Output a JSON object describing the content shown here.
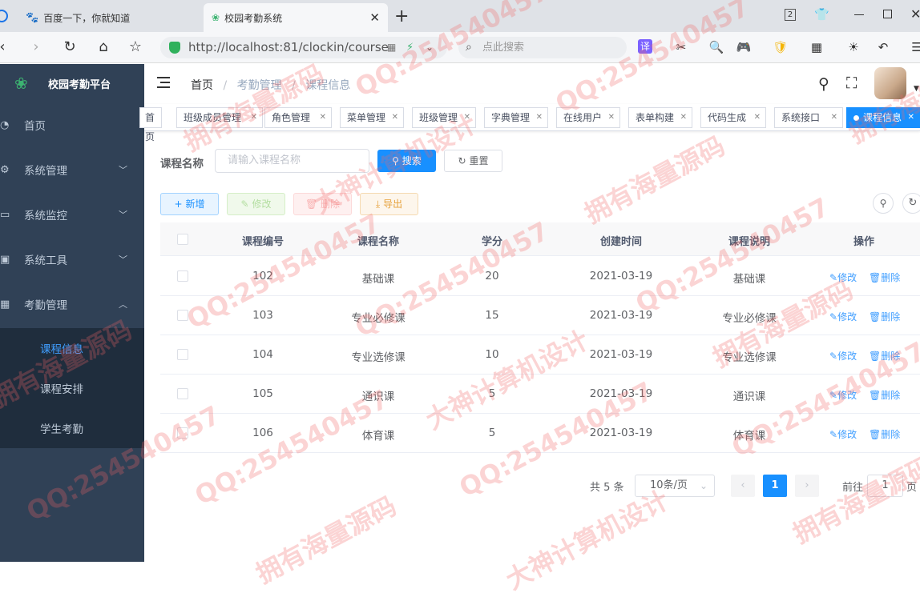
{
  "browser": {
    "tabs": [
      {
        "title": "百度一下，你就知道",
        "icon": "baidu-paw-icon"
      },
      {
        "title": "校园考勤系统",
        "icon": "app-logo-icon"
      }
    ],
    "tab_count": "2",
    "url_host": "http://localhost",
    "url_rest": ":81/clockin/course",
    "search_placeholder": "点此搜索",
    "translate_label": "译"
  },
  "app": {
    "name": "校园考勤平台",
    "breadcrumb": [
      "首页",
      "考勤管理",
      "课程信息"
    ]
  },
  "sidebar": {
    "items": [
      {
        "label": "首页",
        "icon": "dashboard-icon",
        "arrow": false
      },
      {
        "label": "系统管理",
        "icon": "gear-icon",
        "arrow": true
      },
      {
        "label": "系统监控",
        "icon": "monitor-icon",
        "arrow": true
      },
      {
        "label": "系统工具",
        "icon": "toolbox-icon",
        "arrow": true
      },
      {
        "label": "考勤管理",
        "icon": "table-icon",
        "arrow": true
      }
    ],
    "subitems": [
      {
        "label": "课程信息",
        "active": true
      },
      {
        "label": "课程安排",
        "active": false
      },
      {
        "label": "学生考勤",
        "active": false
      }
    ]
  },
  "tags": [
    {
      "label": "首页",
      "active": false
    },
    {
      "label": "班级成员管理",
      "active": false
    },
    {
      "label": "角色管理",
      "active": false
    },
    {
      "label": "菜单管理",
      "active": false
    },
    {
      "label": "班级管理",
      "active": false
    },
    {
      "label": "字典管理",
      "active": false
    },
    {
      "label": "在线用户",
      "active": false
    },
    {
      "label": "表单构建",
      "active": false
    },
    {
      "label": "代码生成",
      "active": false
    },
    {
      "label": "系统接口",
      "active": false
    },
    {
      "label": "课程信息",
      "active": true
    }
  ],
  "query": {
    "label": "课程名称",
    "placeholder": "请输入课程名称",
    "search_label": "搜索",
    "reset_label": "重置"
  },
  "toolbar": {
    "add_label": "新增",
    "edit_label": "修改",
    "delete_label": "删除",
    "export_label": "导出"
  },
  "table": {
    "headers": [
      "课程编号",
      "课程名称",
      "学分",
      "创建时间",
      "课程说明",
      "操作"
    ],
    "rows": [
      {
        "id": "102",
        "name": "基础课",
        "credit": "20",
        "created": "2021-03-19",
        "desc": "基础课"
      },
      {
        "id": "103",
        "name": "专业必修课",
        "credit": "15",
        "created": "2021-03-19",
        "desc": "专业必修课"
      },
      {
        "id": "104",
        "name": "专业选修课",
        "credit": "10",
        "created": "2021-03-19",
        "desc": "专业选修课"
      },
      {
        "id": "105",
        "name": "通识课",
        "credit": "5",
        "created": "2021-03-19",
        "desc": "通识课"
      },
      {
        "id": "106",
        "name": "体育课",
        "credit": "5",
        "created": "2021-03-19",
        "desc": "体育课"
      }
    ],
    "edit_label": "修改",
    "delete_label": "删除"
  },
  "pagination": {
    "total": "共 5 条",
    "page_size": "10条/页",
    "current": "1",
    "goto_label": "前往",
    "goto_value": "1",
    "page_suffix": "页"
  },
  "watermarks": [
    "QQ:254540457",
    "拥有海量源码",
    "大神计算机设计"
  ],
  "colors": {
    "primary": "#1890ff",
    "sidebar": "#304156",
    "submenu": "#1f2d3d",
    "success": "#67c23a",
    "danger": "#f56c6c",
    "warning": "#e6a23c"
  }
}
